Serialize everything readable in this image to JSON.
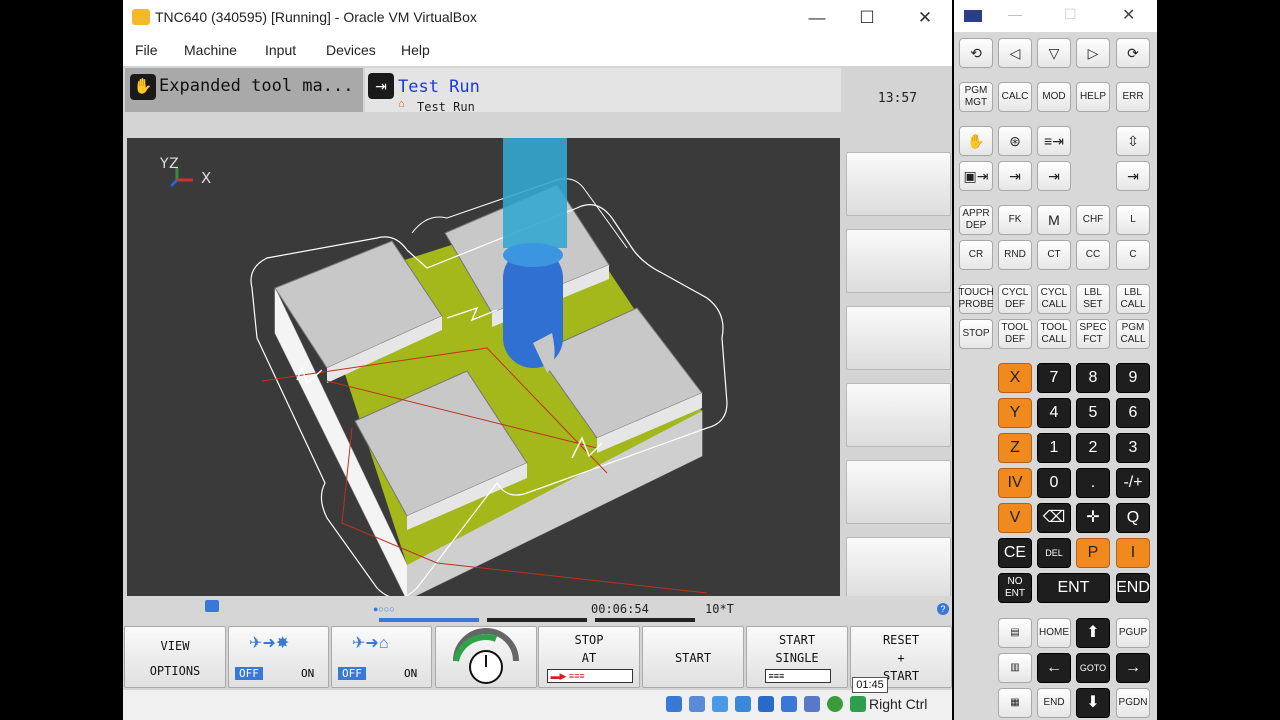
{
  "window": {
    "title": "TNC640 (340595) [Running] - Oracle VM VirtualBox",
    "minimize": "—",
    "maximize": "☐",
    "close": "✕"
  },
  "menu": [
    "File",
    "Machine",
    "Input",
    "Devices",
    "Help"
  ],
  "tnc": {
    "mode_machine": "Expanded tool ma...",
    "mode_program": "Test Run",
    "mode_program_sub": "Test Run",
    "clock": "13:57",
    "axes": {
      "y": "Y",
      "z": "Z",
      "x": "X"
    },
    "run_time": "00:06:54",
    "tool_status": "10*T",
    "softkeys": {
      "view_options": [
        "VIEW",
        "OPTIONS"
      ],
      "toggle1": {
        "off": "OFF",
        "on": "ON"
      },
      "toggle2": {
        "off": "OFF",
        "on": "ON"
      },
      "stop_at": [
        "STOP",
        "AT"
      ],
      "start": "START",
      "start_single": [
        "START",
        "SINGLE"
      ],
      "reset_start": [
        "RESET",
        "+",
        "START"
      ]
    }
  },
  "taskbar": {
    "right_ctrl": "Right Ctrl",
    "clock_popup": "01:45"
  },
  "keypad": {
    "nav": [
      "⟲",
      "◁",
      "▽",
      "▷",
      "⟳"
    ],
    "row1": [
      "PGM MGT",
      "CALC",
      "MOD",
      "HELP",
      "ERR"
    ],
    "row_prog1": [
      "APPR DEP",
      "FK",
      "M",
      "CHF",
      "L"
    ],
    "row_prog2": [
      "CR",
      "RND",
      "CT",
      "CC",
      "C"
    ],
    "row_cycle1": [
      "TOUCH PROBE",
      "CYCL DEF",
      "CYCL CALL",
      "LBL SET",
      "LBL CALL"
    ],
    "row_cycle2": [
      "STOP",
      "TOOL DEF",
      "TOOL CALL",
      "SPEC FCT",
      "PGM CALL"
    ],
    "axes": [
      "X",
      "Y",
      "Z",
      "IV",
      "V"
    ],
    "digits": [
      "7",
      "8",
      "9",
      "4",
      "5",
      "6",
      "1",
      "2",
      "3",
      "0",
      ".",
      "-/+"
    ],
    "misc": {
      "backspace": "⌫",
      "center": "✛",
      "q": "Q",
      "ce": "CE",
      "del": "DEL",
      "p": "P",
      "i": "I",
      "no_ent": "NO ENT",
      "ent": "ENT",
      "end": "END"
    },
    "bottom": {
      "home": "HOME",
      "up": "⬆",
      "pgup": "PGUP",
      "left": "←",
      "goto": "GOTO",
      "right": "→",
      "end": "END",
      "down": "⬇",
      "pgdn": "PGDN"
    }
  },
  "colors": {
    "accent_orange": "#f08a1e",
    "tnc_blue": "#1a3ad6",
    "part_green": "#a4b81c"
  }
}
